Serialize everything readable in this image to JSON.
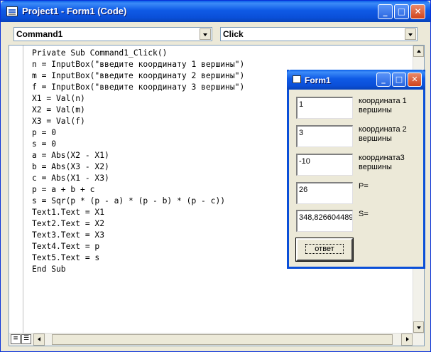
{
  "window": {
    "title": "Project1 - Form1 (Code)",
    "buttons": {
      "minimize": "_",
      "maximize": "□",
      "close": "✕"
    }
  },
  "object_combo": {
    "value": "Command1"
  },
  "procedure_combo": {
    "value": "Click"
  },
  "code": {
    "lines": [
      "Private Sub Command1_Click()",
      "n = InputBox(\"введите координату 1 вершины\")",
      "m = InputBox(\"введите координату 2 вершины\")",
      "f = InputBox(\"введите координату 3 вершины\")",
      "X1 = Val(n)",
      "X2 = Val(m)",
      "X3 = Val(f)",
      "p = 0",
      "s = 0",
      "a = Abs(X2 - X1)",
      "b = Abs(X3 - X2)",
      "c = Abs(X1 - X3)",
      "p = a + b + c",
      "s = Sqr(p * (p - a) * (p - b) * (p - c))",
      "Text1.Text = X1",
      "Text2.Text = X2",
      "Text3.Text = X3",
      "Text4.Text = p",
      "Text5.Text = s",
      "End Sub"
    ]
  },
  "form1": {
    "title": "Form1",
    "fields": [
      {
        "value": "1",
        "label": "координата 1 вершины"
      },
      {
        "value": "3",
        "label": "координата 2 вершины"
      },
      {
        "value": "-10",
        "label": "координата3 вершины"
      },
      {
        "value": "26",
        "label": "P="
      },
      {
        "value": "348,826604489",
        "label": "S="
      }
    ],
    "button_label": "ответ"
  },
  "colors": {
    "titlebar": "#0a4fd8",
    "face": "#ece9d8",
    "close": "#d2441c"
  }
}
